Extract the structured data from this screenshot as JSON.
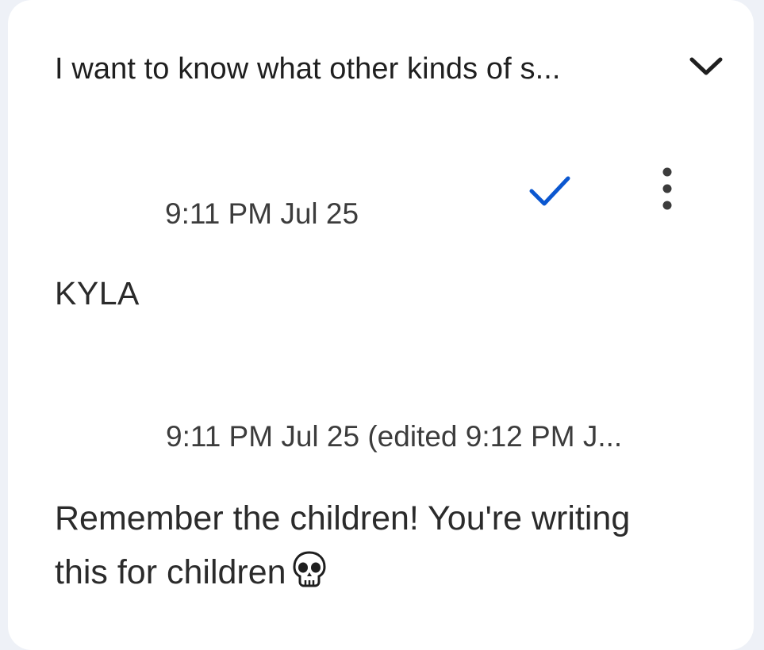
{
  "thread": {
    "title": "I want to know what other kinds of s..."
  },
  "comments": [
    {
      "timestamp": "9:11 PM Jul 25",
      "author": "KYLA"
    },
    {
      "timestamp": "9:11 PM Jul 25 (edited 9:12 PM J...",
      "body": "Remember the children! You're writing this for children"
    }
  ],
  "colors": {
    "accent": "#0b57d0",
    "background": "#eef1f7",
    "card": "#ffffff",
    "text": "#1f1f1f"
  },
  "icons": {
    "expand": "chevron-down-icon",
    "resolve": "checkmark-icon",
    "menu": "more-vertical-icon",
    "emoji": "skull-emoji"
  }
}
